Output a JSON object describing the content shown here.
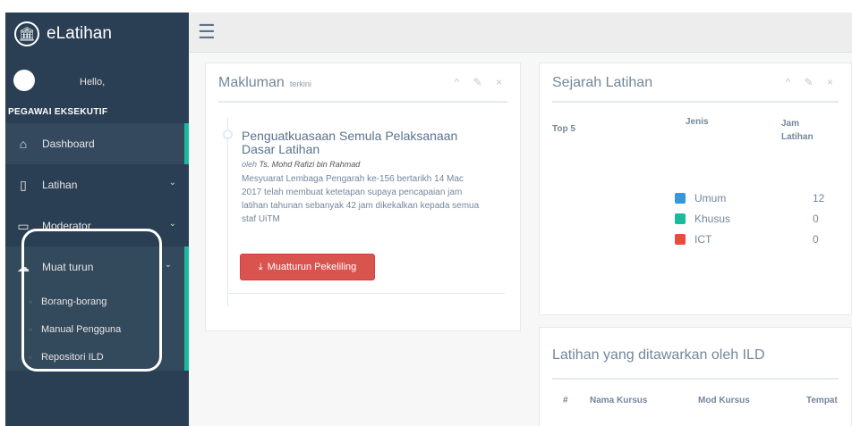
{
  "app": {
    "brand": "eLatihan",
    "brand_icon": "university-icon"
  },
  "profile": {
    "greeting": "Hello,",
    "role": "PEGAWAI EKSEKUTIF"
  },
  "sidebar": {
    "items": [
      {
        "label": "Dashboard",
        "icon": "home-icon"
      },
      {
        "label": "Latihan",
        "icon": "book-icon",
        "chevron": "⌄"
      },
      {
        "label": "Moderator",
        "icon": "desktop-icon",
        "chevron": "⌄"
      },
      {
        "label": "Muat turun",
        "icon": "cloud-download-icon",
        "chevron": "⌄"
      }
    ],
    "submenu": [
      "Borang-borang",
      "Manual Pengguna",
      "Repositori ILD"
    ]
  },
  "announcements": {
    "title": "Makluman",
    "subtitle": "terkini",
    "tools": "^ ✎ ×",
    "item_title": "Penguatkuasaan Semula Pelaksanaan Dasar Latihan",
    "author_prefix": "oleh",
    "author": "Ts. Mohd Rafizi bin Rahmad",
    "body": "Mesyuarat Lembaga Pengarah ke-156 bertarikh 14 Mac 2017 telah membuat ketetapan supaya pencapaian jam latihan tahunan sebanyak 42 jam dikekalkan kepada semua staf UiTM",
    "button": "Muatturun Pekeliling"
  },
  "history": {
    "title": "Sejarah Latihan",
    "tools": "^ ✎ ×",
    "top5": "Top 5",
    "col_type": "Jenis",
    "col_hours": "Jam Latihan",
    "rows": [
      {
        "label": "Umum",
        "value": "12",
        "color": "#3498db"
      },
      {
        "label": "Khusus",
        "value": "0",
        "color": "#1abb9c"
      },
      {
        "label": "ICT",
        "value": "0",
        "color": "#e74c3c"
      }
    ]
  },
  "offered": {
    "title": "Latihan yang ditawarkan oleh ILD",
    "columns": [
      "#",
      "Nama Kursus",
      "Mod Kursus",
      "Tempat"
    ]
  },
  "colors": {
    "sidebar": "#2a3f54",
    "accent": "#1abb9c",
    "danger": "#d9534f"
  }
}
